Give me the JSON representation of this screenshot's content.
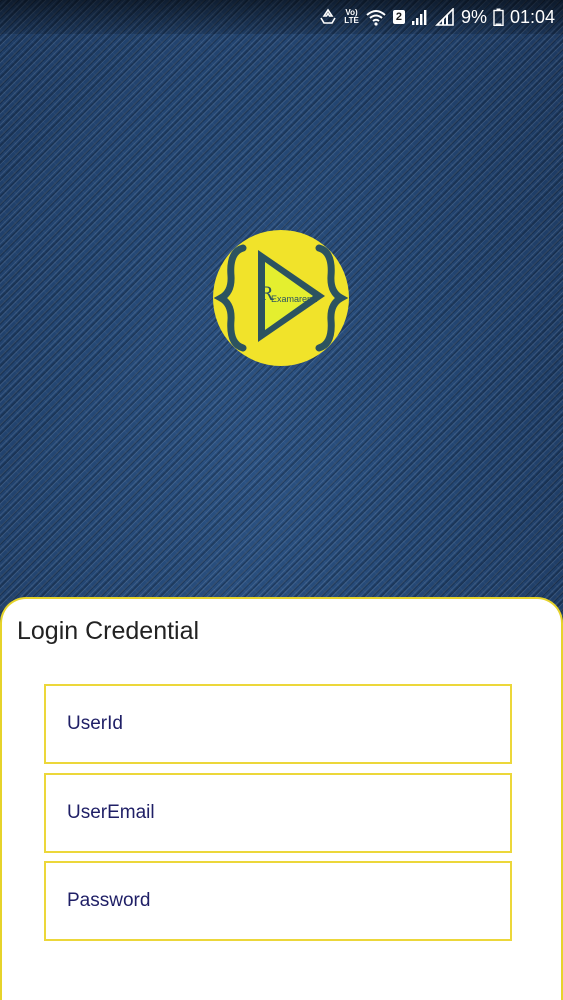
{
  "status_bar": {
    "icons": [
      "sync-icon",
      "volte-icon",
      "wifi-icon",
      "sim-2-icon",
      "signal-1-icon",
      "signal-2-icon",
      "battery-icon"
    ],
    "volte_top": "Vo)",
    "volte_bottom": "LTE",
    "sim_slot": "2",
    "battery": "9%",
    "time": "01:04"
  },
  "logo": {
    "letter": "R",
    "text": "Examarena"
  },
  "login": {
    "title": "Login Credential",
    "fields": [
      {
        "placeholder": "UserId",
        "value": ""
      },
      {
        "placeholder": "UserEmail",
        "value": ""
      },
      {
        "placeholder": "Password",
        "value": ""
      }
    ]
  },
  "colors": {
    "accent": "#ecd73a",
    "logo_yellow": "#f1e32a",
    "logo_dark": "#2c5360",
    "background": "#1f3d66"
  }
}
